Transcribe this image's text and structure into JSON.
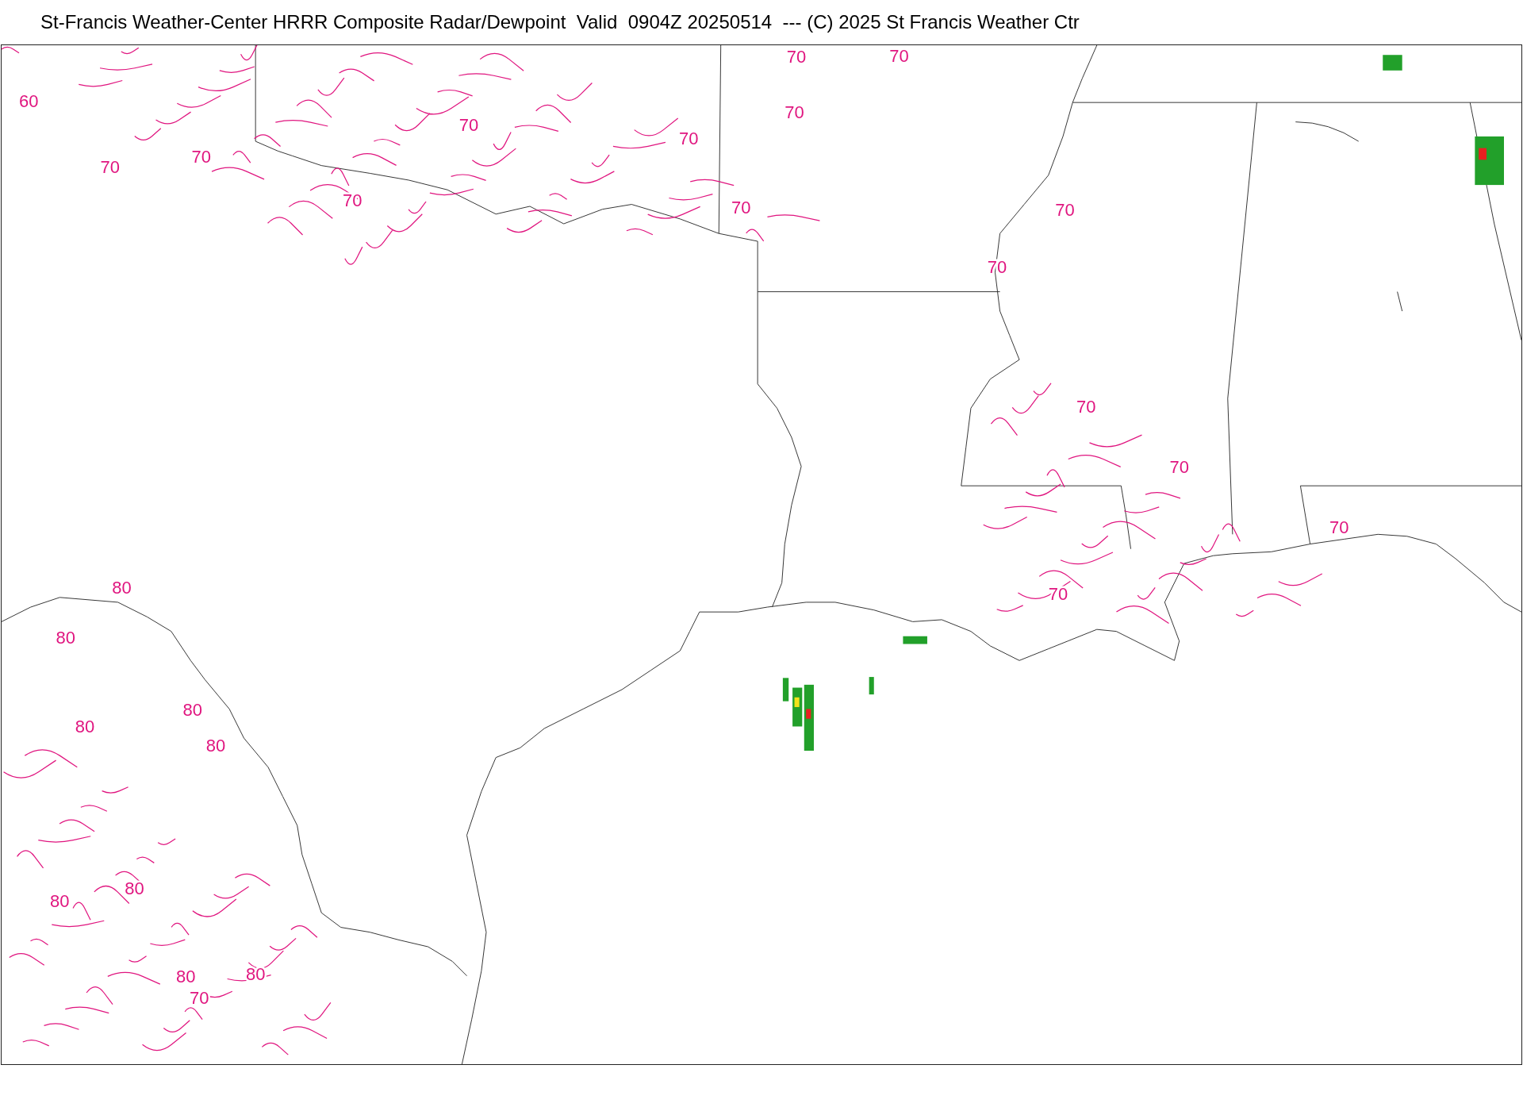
{
  "title": "St-Francis Weather-Center HRRR Composite Radar/Dewpoint  Valid  0904Z 20250514  --- (C) 2025 St Francis Weather Ctr",
  "contour_labels": [
    "60",
    "70",
    "70",
    "70",
    "70",
    "70",
    "70",
    "70",
    "70",
    "70",
    "70",
    "70",
    "70",
    "70",
    "70",
    "70",
    "80",
    "80",
    "80",
    "80",
    "80",
    "80",
    "80",
    "80",
    "80",
    "70"
  ]
}
